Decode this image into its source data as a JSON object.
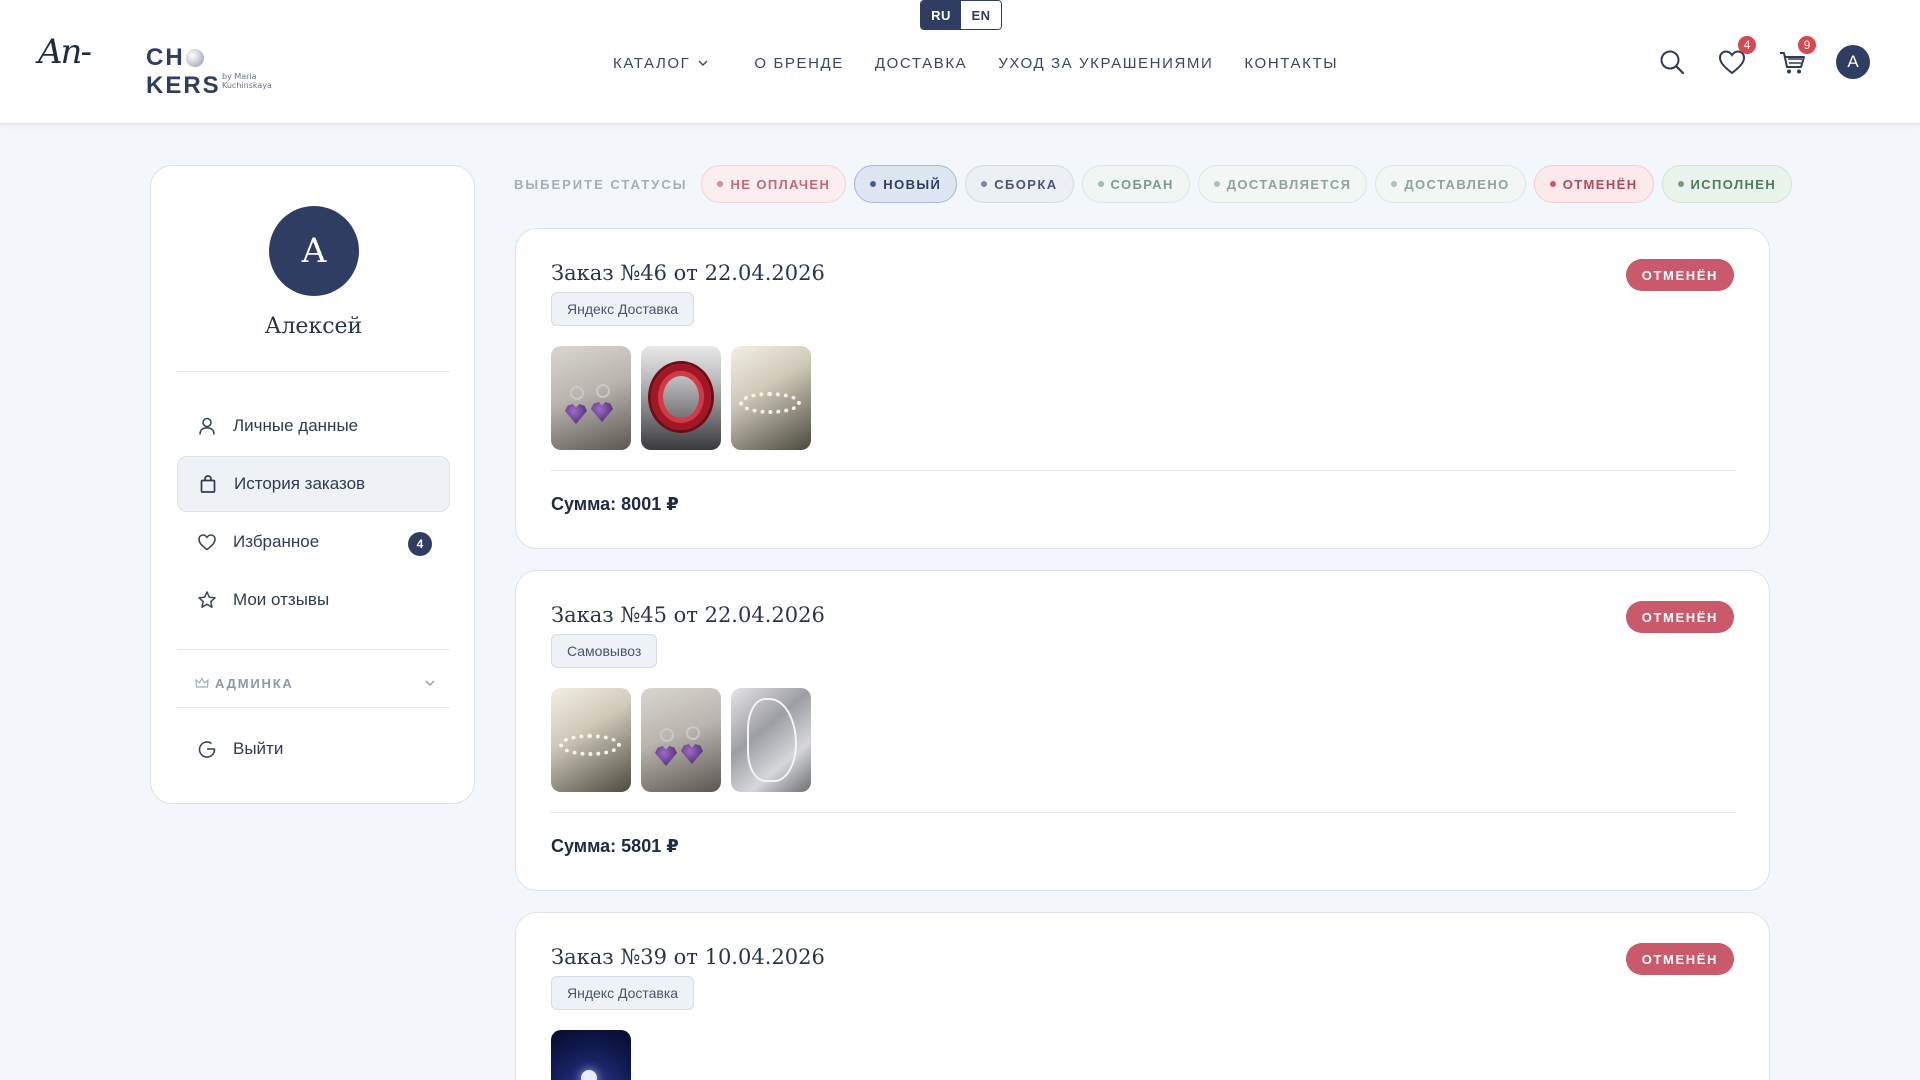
{
  "header": {
    "lang": {
      "ru": "RU",
      "en": "EN",
      "active": "RU"
    },
    "logo": {
      "script": "An-",
      "main_left": "CH",
      "main_right": "KERS",
      "sub": "by Maria Kuchinskaya"
    },
    "nav": [
      {
        "label": "КАТАЛОГ",
        "dropdown": true
      },
      {
        "label": "О БРЕНДЕ"
      },
      {
        "label": "ДОСТАВКА"
      },
      {
        "label": "УХОД ЗА УКРАШЕНИЯМИ"
      },
      {
        "label": "КОНТАКТЫ"
      }
    ],
    "icons": {
      "search": "search-icon",
      "favorites": {
        "icon": "heart-icon",
        "badge": "4"
      },
      "cart": {
        "icon": "cart-icon",
        "badge": "9"
      }
    },
    "avatar_letter": "A"
  },
  "sidebar": {
    "avatar_letter": "A",
    "user_name": "Алексей",
    "items": [
      {
        "label": "Личные данные",
        "icon": "user-icon"
      },
      {
        "label": "История заказов",
        "icon": "bag-icon",
        "active": true
      },
      {
        "label": "Избранное",
        "icon": "heart-icon",
        "count": "4"
      },
      {
        "label": "Мои отзывы",
        "icon": "star-icon"
      }
    ],
    "admin_label": "АДМИНКА",
    "logout_label": "Выйти"
  },
  "filters": {
    "label": "ВЫБЕРИТЕ СТАТУСЫ",
    "chips": [
      {
        "label": "НЕ ОПЛАЧЕН",
        "text": "#c06a78",
        "bg": "#fbeef0",
        "border": "#f1d3d8",
        "dot": "#d68a96"
      },
      {
        "label": "НОВЫЙ",
        "text": "#2f3d63",
        "bg": "#dfe6f3",
        "border": "#a8b6d3",
        "dot": "#4b5f8f",
        "selected": true
      },
      {
        "label": "СБОРКА",
        "text": "#4b5673",
        "bg": "#eceff4",
        "border": "#d3d9e3",
        "dot": "#7b86a0"
      },
      {
        "label": "СОБРАН",
        "text": "#7d9a8e",
        "bg": "#f1f6f4",
        "border": "#dbe7e2",
        "dot": "#9fbcb0"
      },
      {
        "label": "ДОСТАВЛЯЕТСЯ",
        "text": "#8ea59b",
        "bg": "#f2f6f4",
        "border": "#dde7e2",
        "dot": "#aac2b7"
      },
      {
        "label": "ДОСТАВЛЕНО",
        "text": "#8ea59b",
        "bg": "#f2f6f4",
        "border": "#dde7e2",
        "dot": "#aac2b7"
      },
      {
        "label": "ОТМЕНЁН",
        "text": "#b04a5c",
        "bg": "#fbe9ec",
        "border": "#efcdd3",
        "dot": "#c9596b"
      },
      {
        "label": "ИСПОЛНЕН",
        "text": "#4e7d5b",
        "bg": "#eaf4ec",
        "border": "#cfe3d4",
        "dot": "#6fa07d"
      }
    ]
  },
  "orders": [
    {
      "title": "Заказ №46 от 22.04.2026",
      "delivery": "Яндекс Доставка",
      "status": "ОТМЕНЁН",
      "items": [
        "heart-earrings",
        "red-choker",
        "pearl-bracelet"
      ],
      "sum": "Сумма: 8001 ₽"
    },
    {
      "title": "Заказ №45 от 22.04.2026",
      "delivery": "Самовывоз",
      "status": "ОТМЕНЁН",
      "items": [
        "pearl-bracelet",
        "heart-earrings",
        "silver-chain"
      ],
      "sum": "Сумма: 5801 ₽"
    },
    {
      "title": "Заказ №39 от 10.04.2026",
      "delivery": "Яндекс Доставка",
      "status": "ОТМЕНЁН",
      "items": [
        "navy-pendant"
      ],
      "sum": ""
    }
  ],
  "colors": {
    "brand": "#2f3d63",
    "cancelled": "#c9596b",
    "badge": "#d9474f"
  }
}
